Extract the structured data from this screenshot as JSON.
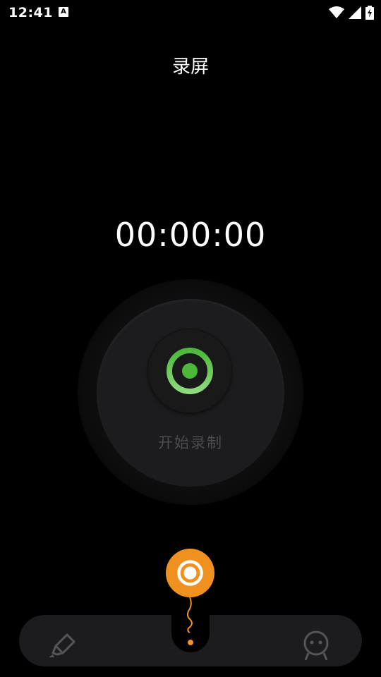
{
  "status_bar": {
    "time": "12:41",
    "notification_icon": "A",
    "icons": [
      "wifi-icon",
      "signal-icon",
      "battery-charging-icon"
    ]
  },
  "screen": {
    "title": "录屏",
    "timer": "00:00:00"
  },
  "record_button": {
    "label": "开始录制",
    "accent_color": "#5fc34a"
  },
  "bottom_nav": {
    "left_icon": "brush-icon",
    "center_icon": "screen-record-icon",
    "right_icon": "robot-icon",
    "center_color": "#f0901e"
  }
}
